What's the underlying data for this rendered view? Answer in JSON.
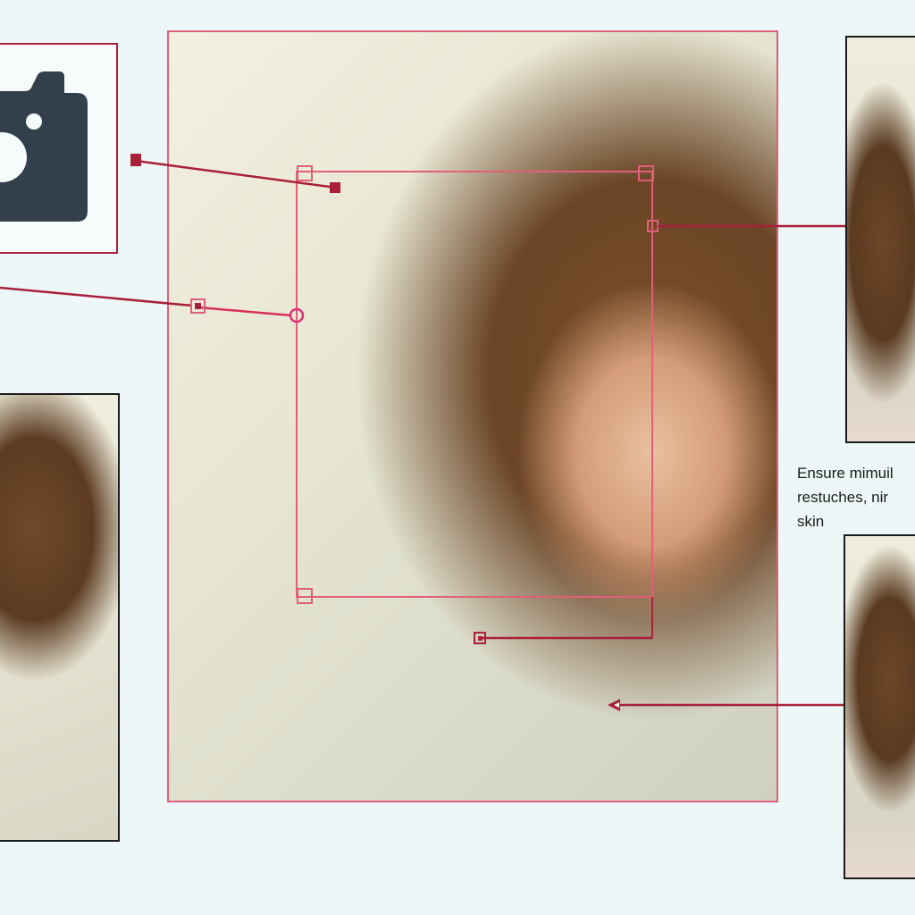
{
  "side_note": {
    "line1": "Ensure mimuil",
    "line2": "restuches, nir",
    "line3": "skin"
  },
  "icons": {
    "camera": "camera-icon"
  },
  "colors": {
    "background": "#eef7f7",
    "annotation_dark": "#a8203a",
    "annotation_pink": "#e0607a",
    "icon_dark": "#333f4a",
    "thumb_border": "#1b1b1b"
  }
}
